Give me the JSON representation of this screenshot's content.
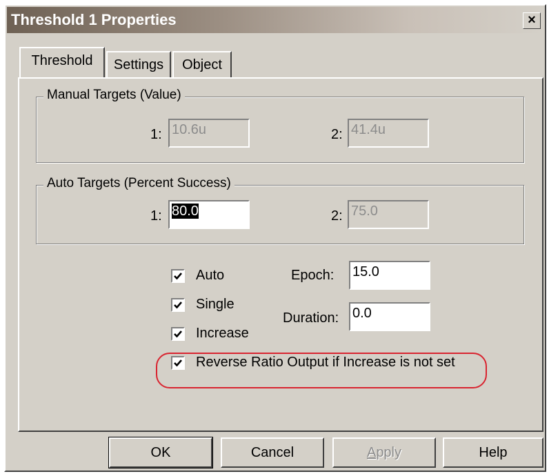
{
  "window": {
    "title": "Threshold 1 Properties",
    "close_label": "×"
  },
  "tabs": [
    {
      "label": "Threshold",
      "active": true
    },
    {
      "label": "Settings",
      "active": false
    },
    {
      "label": "Object",
      "active": false
    }
  ],
  "manual_targets": {
    "legend": "Manual Targets (Value)",
    "label1": "1:",
    "value1": "10.6u",
    "label2": "2:",
    "value2": "41.4u"
  },
  "auto_targets": {
    "legend": "Auto Targets (Percent Success)",
    "label1": "1:",
    "value1": "80.0",
    "label2": "2:",
    "value2": "75.0"
  },
  "options": {
    "auto": {
      "label": "Auto",
      "checked": true
    },
    "single": {
      "label": "Single",
      "checked": true
    },
    "increase": {
      "label": "Increase",
      "checked": true
    },
    "reverse": {
      "label": "Reverse Ratio Output if Increase is not set",
      "checked": true
    }
  },
  "epoch": {
    "label": "Epoch:",
    "value": "15.0"
  },
  "duration": {
    "label": "Duration:",
    "value": "0.0"
  },
  "buttons": {
    "ok": "OK",
    "cancel": "Cancel",
    "apply_prefix": "A",
    "apply_rest": "pply",
    "help": "Help"
  },
  "colors": {
    "dialog_face": "#d4d0c8",
    "highlight_ring": "#d9232f",
    "title_gradient_start": "#6e6154"
  }
}
